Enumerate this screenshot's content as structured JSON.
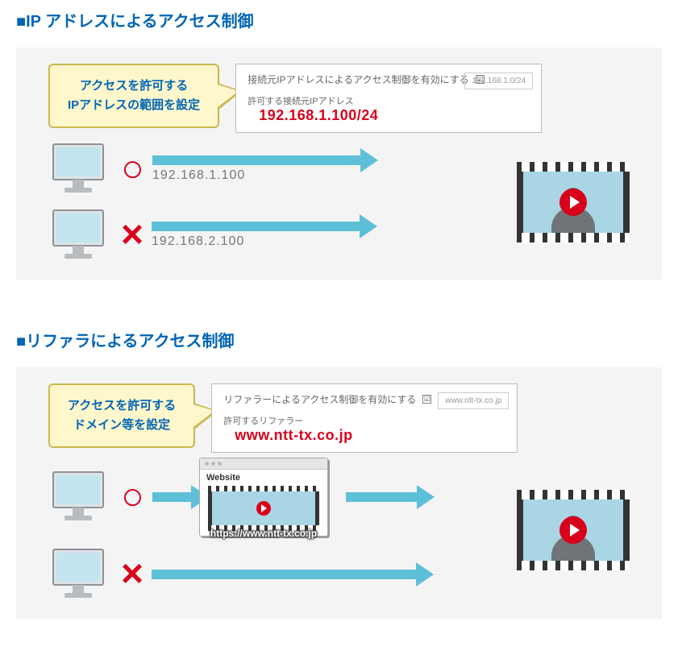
{
  "section1": {
    "title": "■IP アドレスによるアクセス制御",
    "callout_line1": "アクセスを許可する",
    "callout_line2": "IPアドレスの範囲を設定",
    "config": {
      "enable_label": "接続元IPアドレスによるアクセス制御を有効にする",
      "checkbox": "☑",
      "mini_value": "192.168.1.0/24",
      "allow_label": "許可する接続元IPアドレス",
      "value": "192.168.1.100/24"
    },
    "ok_mark": "○",
    "ng_mark": "×",
    "ok_ip": "192.168.1.100",
    "ng_ip": "192.168.2.100"
  },
  "section2": {
    "title": "■リファラによるアクセス制御",
    "callout_line1": "アクセスを許可する",
    "callout_line2": "ドメイン等を設定",
    "config": {
      "enable_label": "リファラーによるアクセス制御を有効にする",
      "checkbox": "☑",
      "mini_value": "www.ntt-tx.co.jp",
      "allow_label": "許可するリファラー",
      "value": "www.ntt-tx.co.jp"
    },
    "ok_mark": "○",
    "ng_mark": "×",
    "website_label": "Website",
    "website_url": "https://www.ntt-tx.co.jp"
  }
}
